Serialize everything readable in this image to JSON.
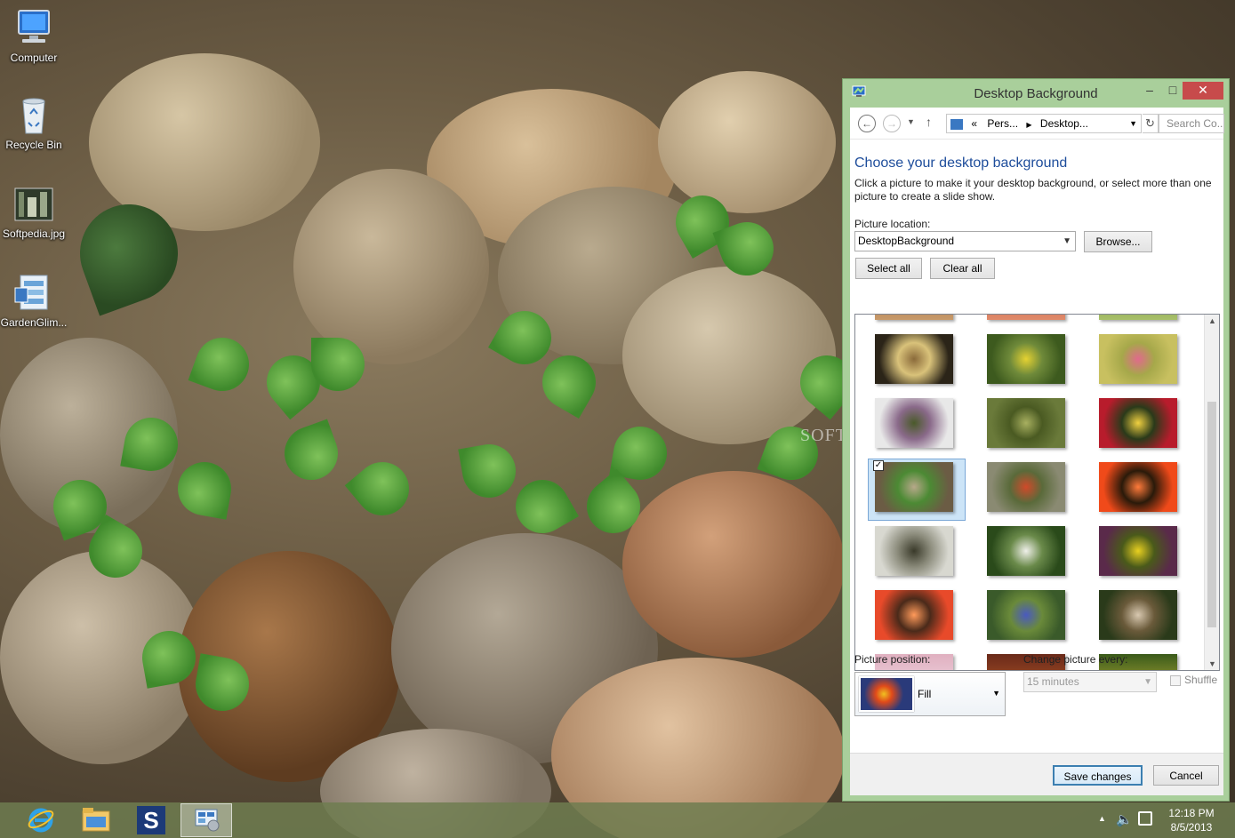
{
  "desktop": {
    "icons": [
      {
        "label": "Computer",
        "icon": "computer-icon"
      },
      {
        "label": "Recycle Bin",
        "icon": "recycle-bin-icon"
      },
      {
        "label": "Softpedia.jpg",
        "icon": "image-file-icon"
      },
      {
        "label": "GardenGlim...",
        "icon": "theme-file-icon"
      }
    ],
    "watermark": "SOFTPEDIA"
  },
  "window": {
    "title": "Desktop Background",
    "nav": {
      "breadcrumb_prefix": "«",
      "crumbs": [
        "Pers...",
        "Desktop..."
      ],
      "search_placeholder": "Search Co..."
    },
    "heading": "Choose your desktop background",
    "description": "Click a picture to make it your desktop background, or select more than one picture to create a slide show.",
    "picture_location_label": "Picture location:",
    "picture_location_value": "DesktopBackground",
    "browse_label": "Browse...",
    "select_all_label": "Select all",
    "clear_all_label": "Clear all",
    "thumbnails": [
      {
        "name": "bokeh-seed-pods",
        "colors": [
          "#2b2418",
          "#8a6a3a",
          "#d9c27a"
        ]
      },
      {
        "name": "yellow-flowers",
        "colors": [
          "#3d5a1e",
          "#e5d232",
          "#6f8a3a"
        ]
      },
      {
        "name": "pink-mimosa",
        "colors": [
          "#c8c060",
          "#e06a8c",
          "#a6a84a"
        ]
      },
      {
        "name": "branch-bird",
        "colors": [
          "#e8e8e8",
          "#4a5a2a",
          "#8a6a8a"
        ]
      },
      {
        "name": "green-meadow",
        "colors": [
          "#6a7a3a",
          "#a8b060",
          "#4a5a22"
        ]
      },
      {
        "name": "red-gerbera",
        "colors": [
          "#b81c2c",
          "#f0d040",
          "#2a3a1a"
        ]
      },
      {
        "name": "pebbles-clover",
        "colors": [
          "#6b5c44",
          "#b7a88a",
          "#4c8a34"
        ],
        "selected": true
      },
      {
        "name": "red-ball-flower",
        "colors": [
          "#8a8a72",
          "#d04a2a",
          "#5a6a3a"
        ]
      },
      {
        "name": "orange-gerbera",
        "colors": [
          "#f04a1a",
          "#ff7a3a",
          "#2a1a0a"
        ]
      },
      {
        "name": "white-branches",
        "colors": [
          "#d8d8d0",
          "#3a3a2a",
          "#8a8a7a"
        ]
      },
      {
        "name": "white-blossoms",
        "colors": [
          "#2a4a1a",
          "#f0f0ea",
          "#6a8a4a"
        ]
      },
      {
        "name": "yellow-cluster",
        "colors": [
          "#5a2a4a",
          "#e8d020",
          "#4a5a1a"
        ]
      },
      {
        "name": "orange-dahlia",
        "colors": [
          "#e84a2a",
          "#ff9a5a",
          "#4a2a1a"
        ]
      },
      {
        "name": "blue-wildflowers",
        "colors": [
          "#3a5a2a",
          "#4a5ac0",
          "#6a8a3a"
        ]
      },
      {
        "name": "dark-berries",
        "colors": [
          "#2a3a1a",
          "#d8c8b0",
          "#6a5a3a"
        ]
      }
    ],
    "picture_position_label": "Picture position:",
    "picture_position_value": "Fill",
    "change_every_label": "Change picture every:",
    "change_every_value": "15 minutes",
    "shuffle_label": "Shuffle",
    "save_label": "Save changes",
    "cancel_label": "Cancel"
  },
  "taskbar": {
    "apps": [
      "internet-explorer-icon",
      "file-explorer-icon",
      "softpedia-s-icon",
      "control-panel-icon"
    ],
    "softpedia_letter": "S",
    "time": "12:18 PM",
    "date": "8/5/2013"
  }
}
